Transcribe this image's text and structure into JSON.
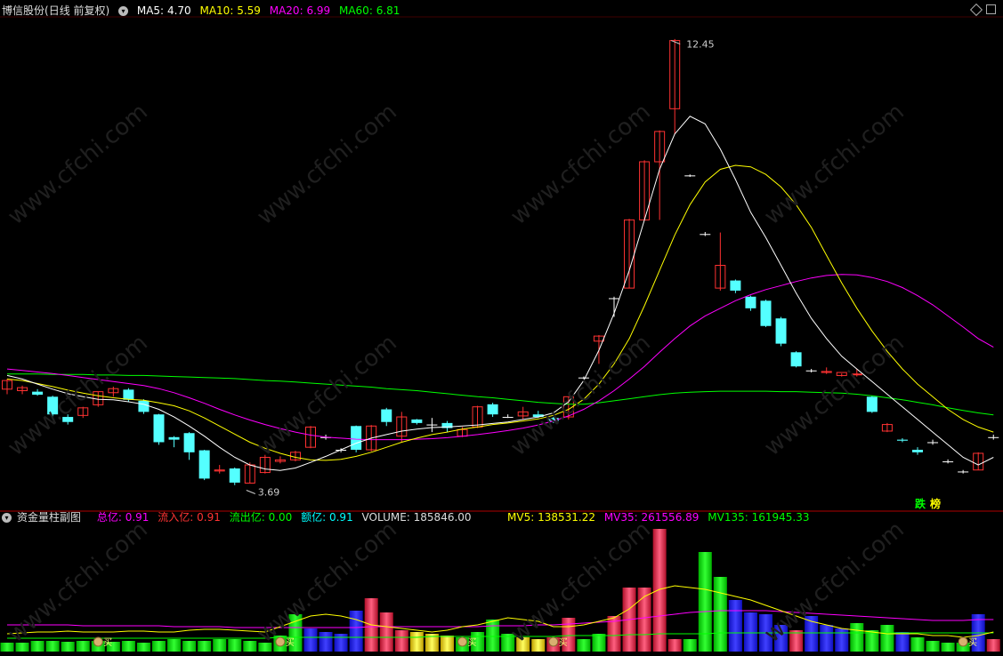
{
  "header": {
    "stock_name": "博信股份",
    "period": "(日线 前复权)",
    "ma5": {
      "label": "MA5:",
      "value": "4.70",
      "color": "#ffffff"
    },
    "ma10": {
      "label": "MA10:",
      "value": "5.59",
      "color": "#ffff00"
    },
    "ma20": {
      "label": "MA20:",
      "value": "6.99",
      "color": "#ff00ff"
    },
    "ma60": {
      "label": "MA60:",
      "value": "6.81",
      "color": "#00ff00"
    }
  },
  "sub_header": {
    "title": "资金量柱副图",
    "total": {
      "label": "总亿:",
      "value": "0.91",
      "color": "#ff00ff"
    },
    "inflow": {
      "label": "流入亿:",
      "value": "0.91",
      "color": "#ff3333"
    },
    "outflow": {
      "label": "流出亿:",
      "value": "0.00",
      "color": "#00ff00"
    },
    "amount": {
      "label": "额亿:",
      "value": "0.91",
      "color": "#00ffff"
    },
    "volume": {
      "label": "VOLUME:",
      "value": "185846.00",
      "color": "#dddddd"
    },
    "mv5": {
      "label": "MV5:",
      "value": "138531.22",
      "color": "#ffff00"
    },
    "mv35": {
      "label": "MV35:",
      "value": "261556.89",
      "color": "#ff00ff"
    },
    "mv135": {
      "label": "MV135:",
      "value": "161945.33",
      "color": "#00ff00"
    }
  },
  "annotations": {
    "high": "12.45",
    "low": "3.69",
    "buy": "买"
  },
  "tags": {
    "die": "跌",
    "bang": "榜"
  },
  "watermark": "www.cfchi.com",
  "chart_data": {
    "type": "candlestick",
    "price_range": [
      3.4,
      12.9
    ],
    "candles": [
      [
        5.55,
        5.72,
        5.45,
        5.75
      ],
      [
        5.52,
        5.58,
        5.45,
        5.62
      ],
      [
        5.5,
        5.44,
        5.42,
        5.55
      ],
      [
        5.4,
        5.05,
        5.0,
        5.42
      ],
      [
        5.0,
        4.9,
        4.85,
        5.05
      ],
      [
        5.03,
        5.18,
        4.98,
        5.2
      ],
      [
        5.24,
        5.5,
        5.2,
        5.5
      ],
      [
        5.48,
        5.56,
        5.4,
        5.6
      ],
      [
        5.54,
        5.34,
        5.3,
        5.57
      ],
      [
        5.32,
        5.1,
        5.06,
        5.35
      ],
      [
        5.05,
        4.5,
        4.45,
        5.06
      ],
      [
        4.6,
        4.55,
        4.4,
        4.62
      ],
      [
        4.68,
        4.3,
        4.15,
        4.7
      ],
      [
        4.34,
        3.78,
        3.75,
        4.35
      ],
      [
        3.93,
        3.95,
        3.88,
        4.05
      ],
      [
        3.98,
        3.7,
        3.65,
        4.0
      ],
      [
        3.69,
        4.05,
        3.69,
        4.1
      ],
      [
        3.9,
        4.2,
        3.88,
        4.25
      ],
      [
        4.12,
        4.15,
        4.08,
        4.22
      ],
      [
        4.15,
        4.3,
        4.12,
        4.33
      ],
      [
        4.4,
        4.8,
        4.38,
        4.82
      ],
      [
        4.6,
        4.6,
        4.55,
        4.65
      ],
      [
        4.35,
        4.35,
        4.3,
        4.38
      ],
      [
        4.82,
        4.35,
        4.3,
        4.83
      ],
      [
        4.35,
        4.82,
        4.32,
        4.84
      ],
      [
        5.15,
        4.9,
        4.82,
        5.18
      ],
      [
        4.62,
        5.0,
        4.5,
        5.1
      ],
      [
        4.95,
        4.88,
        4.85,
        4.96
      ],
      [
        4.85,
        4.85,
        4.7,
        4.98
      ],
      [
        4.88,
        4.78,
        4.7,
        4.92
      ],
      [
        4.62,
        4.75,
        4.6,
        4.8
      ],
      [
        4.8,
        5.2,
        4.78,
        5.22
      ],
      [
        5.25,
        5.05,
        5.0,
        5.28
      ],
      [
        5.0,
        5.0,
        4.98,
        5.05
      ],
      [
        5.02,
        5.1,
        4.95,
        5.2
      ],
      [
        5.05,
        5.0,
        4.98,
        5.12
      ],
      [
        4.98,
        4.92,
        4.88,
        5.0
      ],
      [
        5.0,
        5.4,
        4.95,
        5.4
      ],
      [
        5.78,
        5.78,
        5.75,
        5.8
      ],
      [
        6.5,
        6.6,
        6.05,
        6.62
      ],
      [
        7.35,
        7.35,
        6.98,
        7.38
      ],
      [
        7.55,
        8.9,
        7.55,
        8.92
      ],
      [
        8.9,
        10.05,
        8.88,
        10.08
      ],
      [
        10.05,
        10.65,
        8.9,
        10.67
      ],
      [
        11.1,
        12.45,
        10.6,
        12.48
      ],
      [
        9.78,
        9.78,
        9.75,
        9.8
      ],
      [
        8.62,
        8.62,
        8.58,
        8.66
      ],
      [
        7.55,
        8.0,
        7.5,
        8.65
      ],
      [
        7.7,
        7.5,
        7.45,
        7.72
      ],
      [
        7.38,
        7.15,
        7.1,
        7.4
      ],
      [
        7.3,
        6.8,
        6.78,
        7.32
      ],
      [
        6.95,
        6.45,
        6.4,
        6.98
      ],
      [
        6.28,
        6.0,
        5.98,
        6.3
      ],
      [
        5.92,
        5.92,
        5.88,
        5.95
      ],
      [
        5.88,
        5.9,
        5.85,
        5.98
      ],
      [
        5.82,
        5.88,
        5.8,
        5.86
      ],
      [
        5.84,
        5.85,
        5.8,
        5.95
      ],
      [
        5.4,
        5.1,
        5.08,
        5.42
      ],
      [
        4.72,
        4.85,
        4.7,
        4.88
      ],
      [
        4.55,
        4.53,
        4.5,
        4.58
      ],
      [
        4.35,
        4.3,
        4.25,
        4.4
      ],
      [
        4.5,
        4.5,
        4.45,
        4.55
      ],
      [
        4.12,
        4.12,
        4.08,
        4.16
      ],
      [
        3.92,
        3.92,
        3.88,
        3.95
      ],
      [
        3.95,
        4.28,
        3.95,
        4.3
      ],
      [
        4.6,
        4.6,
        4.55,
        4.65
      ]
    ],
    "ma5": [
      5.82,
      5.75,
      5.65,
      5.55,
      5.46,
      5.4,
      5.35,
      5.34,
      5.3,
      5.25,
      5.15,
      5.0,
      4.82,
      4.62,
      4.4,
      4.2,
      4.05,
      3.97,
      3.94,
      3.99,
      4.1,
      4.22,
      4.35,
      4.48,
      4.58,
      4.65,
      4.72,
      4.76,
      4.79,
      4.8,
      4.82,
      4.84,
      4.87,
      4.9,
      4.95,
      5.0,
      5.08,
      5.3,
      5.72,
      6.32,
      7.05,
      7.9,
      8.9,
      9.9,
      10.6,
      10.95,
      10.8,
      10.3,
      9.7,
      9.05,
      8.55,
      8.0,
      7.45,
      6.95,
      6.55,
      6.2,
      5.95,
      5.7,
      5.45,
      5.2,
      4.95,
      4.7,
      4.45,
      4.2,
      4.05,
      4.2
    ],
    "ma10": [
      5.75,
      5.72,
      5.66,
      5.6,
      5.53,
      5.47,
      5.42,
      5.38,
      5.35,
      5.33,
      5.28,
      5.22,
      5.12,
      4.98,
      4.82,
      4.66,
      4.5,
      4.38,
      4.28,
      4.2,
      4.15,
      4.14,
      4.16,
      4.22,
      4.3,
      4.4,
      4.5,
      4.58,
      4.65,
      4.7,
      4.76,
      4.8,
      4.85,
      4.88,
      4.92,
      4.96,
      5.03,
      5.15,
      5.35,
      5.65,
      6.05,
      6.55,
      7.2,
      7.9,
      8.6,
      9.2,
      9.65,
      9.9,
      9.98,
      9.95,
      9.8,
      9.55,
      9.2,
      8.75,
      8.2,
      7.65,
      7.15,
      6.7,
      6.3,
      5.95,
      5.65,
      5.4,
      5.15,
      4.95,
      4.8,
      4.7
    ],
    "ma20": [
      5.95,
      5.92,
      5.89,
      5.86,
      5.82,
      5.78,
      5.74,
      5.7,
      5.66,
      5.62,
      5.56,
      5.48,
      5.38,
      5.27,
      5.15,
      5.04,
      4.94,
      4.85,
      4.77,
      4.7,
      4.64,
      4.6,
      4.58,
      4.56,
      4.55,
      4.55,
      4.55,
      4.56,
      4.57,
      4.59,
      4.62,
      4.65,
      4.69,
      4.73,
      4.78,
      4.84,
      4.92,
      5.02,
      5.15,
      5.32,
      5.52,
      5.75,
      6.0,
      6.28,
      6.55,
      6.8,
      7.0,
      7.15,
      7.3,
      7.42,
      7.52,
      7.6,
      7.68,
      7.75,
      7.8,
      7.82,
      7.81,
      7.76,
      7.68,
      7.56,
      7.4,
      7.22,
      7.0,
      6.78,
      6.55,
      6.38
    ],
    "ma60": [
      5.85,
      5.85,
      5.85,
      5.84,
      5.84,
      5.84,
      5.83,
      5.83,
      5.82,
      5.82,
      5.81,
      5.8,
      5.79,
      5.78,
      5.77,
      5.76,
      5.74,
      5.72,
      5.71,
      5.69,
      5.67,
      5.65,
      5.63,
      5.61,
      5.59,
      5.56,
      5.54,
      5.52,
      5.49,
      5.46,
      5.43,
      5.4,
      5.38,
      5.35,
      5.32,
      5.29,
      5.27,
      5.25,
      5.25,
      5.28,
      5.32,
      5.36,
      5.4,
      5.44,
      5.47,
      5.49,
      5.5,
      5.51,
      5.51,
      5.51,
      5.51,
      5.5,
      5.5,
      5.49,
      5.48,
      5.47,
      5.45,
      5.42,
      5.38,
      5.34,
      5.29,
      5.24,
      5.18,
      5.13,
      5.08,
      5.04
    ],
    "volume": {
      "values": [
        16000,
        15000,
        14000,
        16000,
        15000,
        16000,
        15000,
        14000,
        17000,
        15000,
        16000,
        18000,
        15000,
        16000,
        19000,
        17000,
        15000,
        14000,
        32000,
        55000,
        60000,
        40000,
        38000,
        55000,
        30000,
        20000,
        26000,
        28000,
        30000,
        35000,
        28000,
        48000,
        46000,
        60000,
        55000,
        26000,
        25000,
        40000,
        46000,
        38000,
        48000,
        38000,
        50000,
        48000,
        46000,
        35000,
        65000,
        30000,
        42000,
        32000,
        38000,
        28000,
        45000,
        28000,
        42000,
        45000,
        42000,
        52000,
        45000,
        32000,
        55000,
        43000,
        35000,
        28000,
        62000,
        30000
      ],
      "colors": [
        "green",
        "green",
        "green",
        "green",
        "green",
        "green",
        "green",
        "green",
        "green",
        "green",
        "green",
        "green",
        "green",
        "green",
        "green",
        "green",
        "green",
        "green",
        "green",
        "green",
        "blue",
        "blue",
        "blue",
        "blue",
        "red",
        "red",
        "red",
        "yellow",
        "yellow",
        "yellow",
        "green",
        "green",
        "green",
        "green",
        "yellow",
        "yellow",
        "red",
        "red",
        "green",
        "green",
        "red",
        "red",
        "red",
        "red",
        "red",
        "green",
        "green",
        "green",
        "blue",
        "blue",
        "blue",
        "blue",
        "red",
        "blue",
        "blue",
        "blue",
        "green",
        "green",
        "green",
        "blue",
        "green",
        "green",
        "green",
        "green",
        "blue",
        "red"
      ],
      "heights": [
        10,
        10,
        12,
        12,
        11,
        12,
        12,
        11,
        12,
        10,
        12,
        14,
        12,
        12,
        14,
        14,
        12,
        10,
        18,
        42,
        26,
        22,
        20,
        46,
        60,
        44,
        24,
        22,
        20,
        18,
        16,
        22,
        36,
        20,
        16,
        14,
        16,
        38,
        14,
        20,
        40,
        72,
        72,
        138,
        14,
        14,
        112,
        84,
        58,
        44,
        42,
        30,
        24,
        40,
        30,
        26,
        32,
        24,
        30,
        22,
        16,
        12,
        10,
        10,
        42,
        14
      ]
    },
    "mv5": [
      20,
      21,
      22,
      22,
      23,
      22,
      22,
      22,
      23,
      23,
      22,
      22,
      24,
      25,
      25,
      24,
      23,
      22,
      28,
      34,
      40,
      42,
      40,
      36,
      30,
      28,
      26,
      24,
      22,
      24,
      28,
      30,
      34,
      38,
      36,
      34,
      28,
      28,
      30,
      34,
      38,
      48,
      62,
      70,
      74,
      72,
      70,
      66,
      62,
      58,
      52,
      46,
      40,
      34,
      30,
      26,
      24,
      22,
      20,
      20,
      20,
      18,
      18,
      16,
      18,
      22
    ],
    "mv35": [
      30,
      30,
      30,
      30,
      30,
      29,
      29,
      29,
      29,
      29,
      29,
      28,
      28,
      28,
      28,
      27,
      27,
      27,
      27,
      27,
      27,
      27,
      27,
      27,
      28,
      28,
      28,
      28,
      28,
      28,
      28,
      28,
      29,
      29,
      29,
      30,
      30,
      31,
      32,
      33,
      34,
      36,
      38,
      40,
      42,
      44,
      45,
      46,
      46,
      46,
      46,
      45,
      44,
      43,
      42,
      41,
      40,
      39,
      38,
      37,
      36,
      35,
      35,
      35,
      36,
      36
    ],
    "mv135": [
      15,
      15,
      15,
      15,
      15,
      15,
      15,
      15,
      15,
      15,
      15,
      15,
      15,
      15,
      15,
      15,
      15,
      15,
      16,
      16,
      16,
      16,
      16,
      16,
      16,
      16,
      16,
      16,
      17,
      17,
      17,
      17,
      17,
      17,
      17,
      17,
      17,
      18,
      18,
      18,
      18,
      19,
      19,
      20,
      20,
      20,
      20,
      21,
      21,
      21,
      21,
      21,
      21,
      21,
      21,
      21,
      21,
      21,
      21,
      21,
      21,
      21,
      21,
      21,
      21,
      21
    ]
  }
}
